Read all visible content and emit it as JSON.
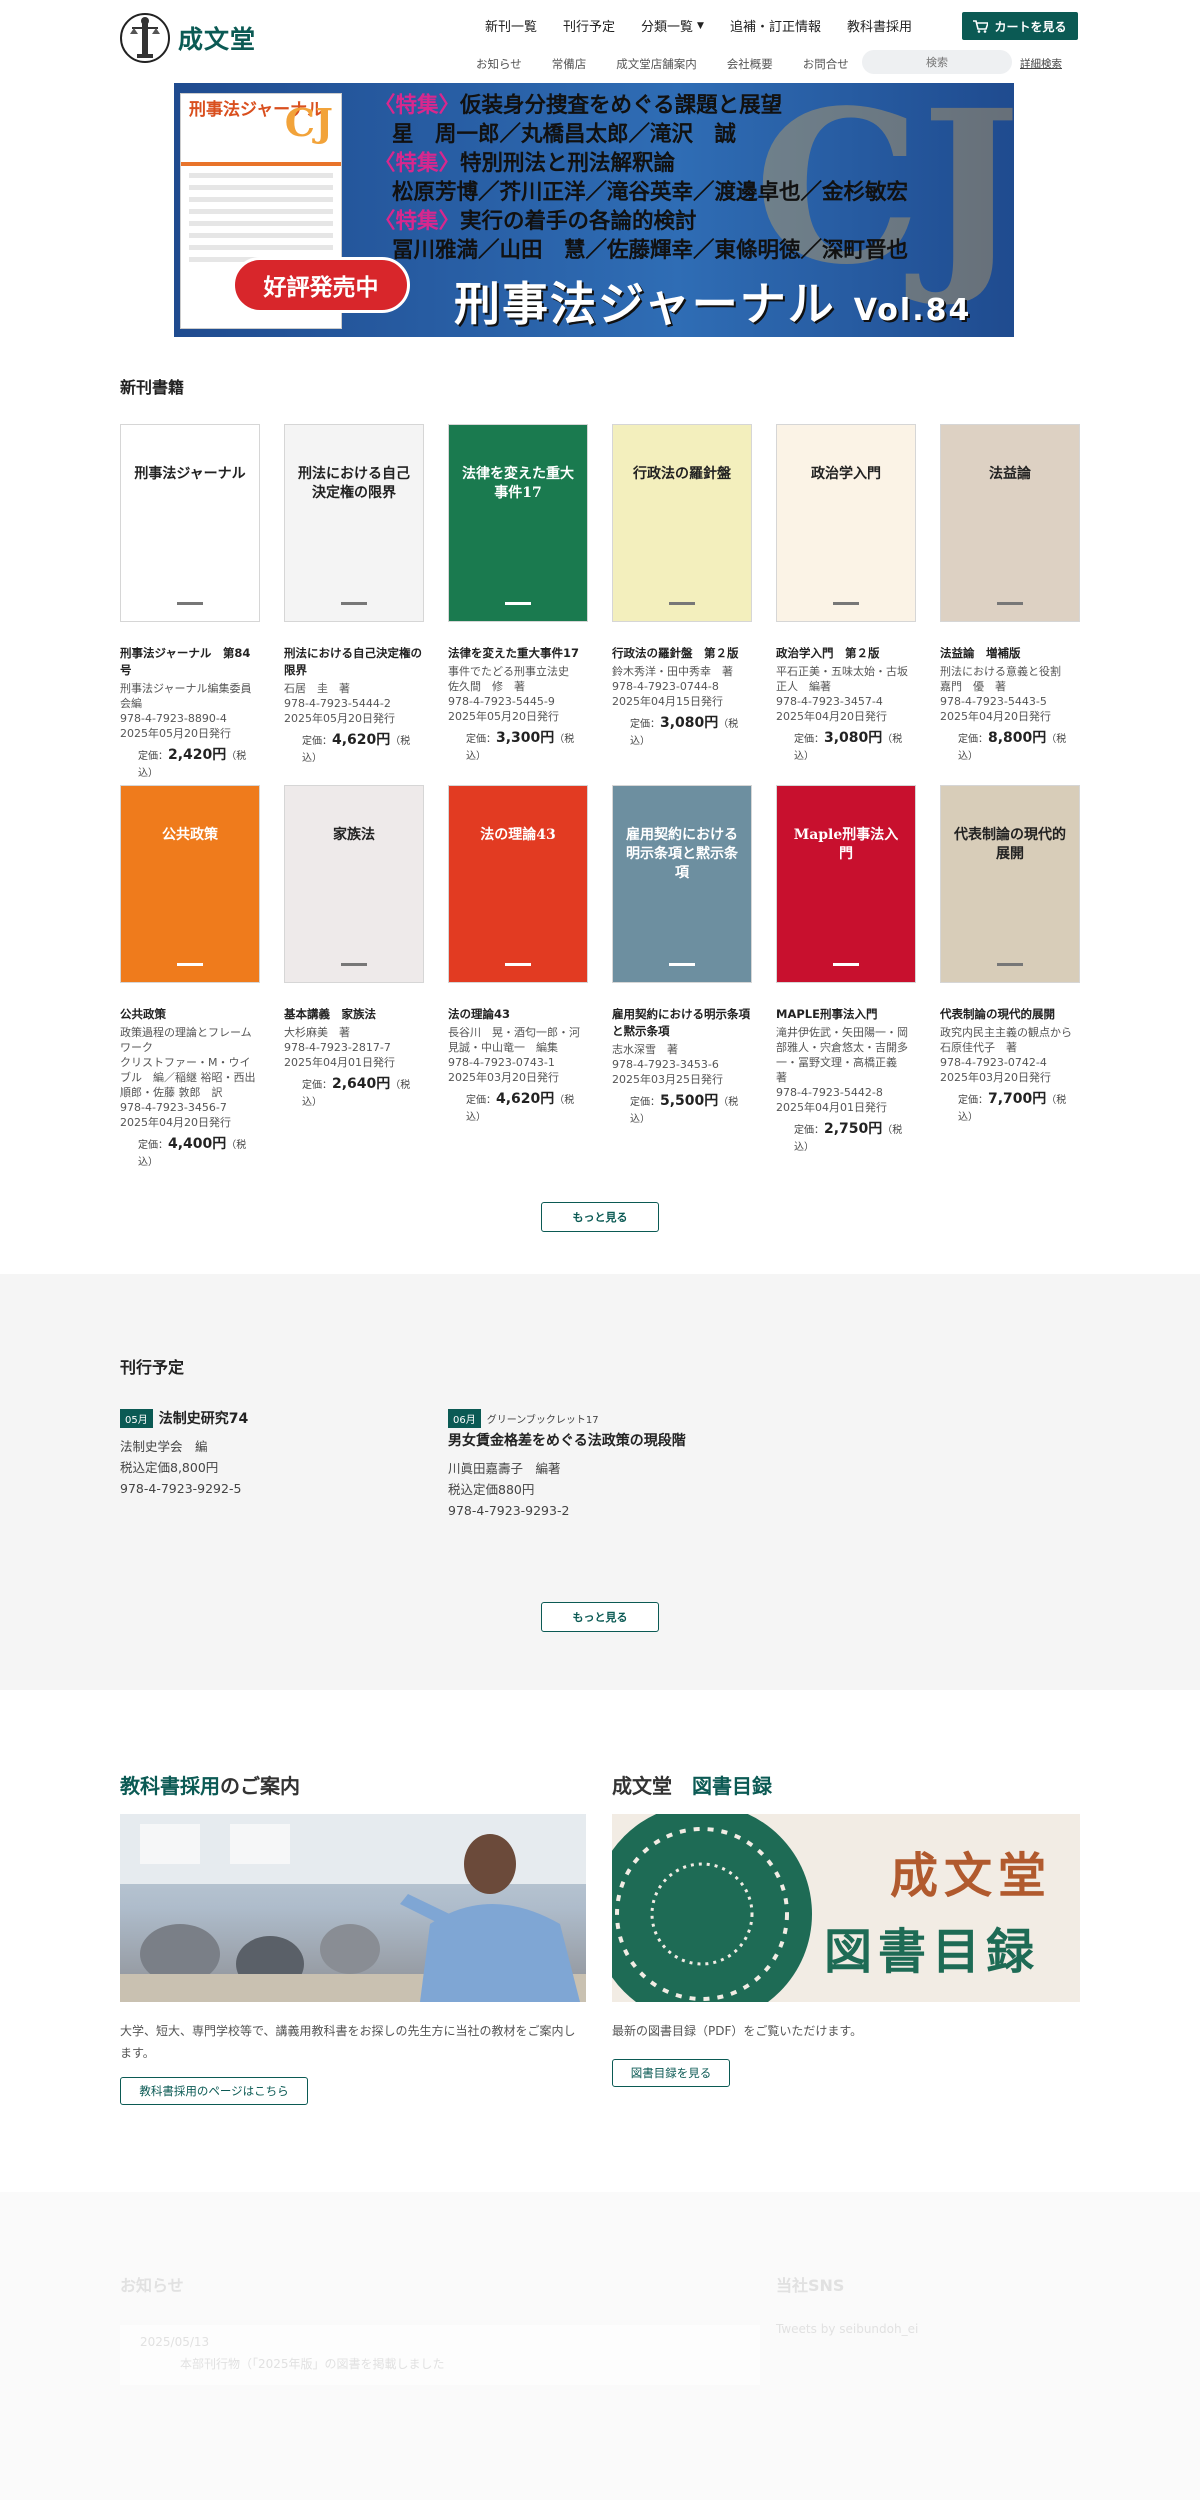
{
  "header": {
    "logo_text": "成文堂",
    "nav_main": [
      "新刊一覧",
      "刊行予定",
      "分類一覧",
      "追補・訂正情報",
      "教科書採用"
    ],
    "cart_label": "カートを見る",
    "nav_sub": [
      "お知らせ",
      "常備店",
      "成文堂店舗案内",
      "会社概要",
      "お問合せ"
    ],
    "search_placeholder": "検索",
    "advanced_search": "詳細検索"
  },
  "banner": {
    "lines": [
      {
        "tag": "〈特集〉",
        "text": "仮装身分捜査をめぐる課題と展望"
      },
      {
        "tag": "",
        "text": "星　周一郎／丸橋昌太郎／滝沢　誠"
      },
      {
        "tag": "〈特集〉",
        "text": "特別刑法と刑法解釈論"
      },
      {
        "tag": "",
        "text": "松原芳博／芥川正洋／滝谷英幸／渡邊卓也／金杉敏宏"
      },
      {
        "tag": "〈特集〉",
        "text": "実行の着手の各論的検討"
      },
      {
        "tag": "",
        "text": "冨川雅満／山田　慧／佐藤輝幸／東條明徳／深町晋也"
      }
    ],
    "badge": "好評発売中",
    "magazine_title": "刑事法ジャーナル",
    "magazine_vol": "Vol.84",
    "cover_title": "刑事法ジャーナル",
    "cover_logo": "CJ"
  },
  "new_books": {
    "title": "新刊書籍",
    "books": [
      {
        "title": "刑事法ジャーナル　第84号",
        "meta": [
          "刑事法ジャーナル編集委員会編",
          "978-4-7923-8890-4",
          "2025年05月20日発行"
        ],
        "price_prefix": "定価：",
        "price": "2,420円",
        "tax": "（税込）",
        "cover_text": "刑事法ジャーナル",
        "cover_color": "#ffffff"
      },
      {
        "title": "刑法における自己決定権の限界",
        "meta": [
          "石居　圭　著",
          "978-4-7923-5444-2",
          "2025年05月20日発行"
        ],
        "price_prefix": "定価：",
        "price": "4,620円",
        "tax": "（税込）",
        "cover_text": "刑法における自己決定権の限界",
        "cover_color": "#f4f4f4"
      },
      {
        "title": "法律を変えた重大事件17",
        "meta": [
          "事件でたどる刑事立法史",
          "佐久間　修　著",
          "978-4-7923-5445-9",
          "2025年05月20日発行"
        ],
        "price_prefix": "定価：",
        "price": "3,300円",
        "tax": "（税込）",
        "cover_text": "法律を変えた重大事件17",
        "cover_color": "#1a7a4f"
      },
      {
        "title": "行政法の羅針盤　第２版",
        "meta": [
          "鈴木秀洋・田中秀幸　著",
          "978-4-7923-0744-8",
          "2025年04月15日発行"
        ],
        "price_prefix": "定価：",
        "price": "3,080円",
        "tax": "（税込）",
        "cover_text": "行政法の羅針盤",
        "cover_color": "#f3efbd"
      },
      {
        "title": "政治学入門　第２版",
        "meta": [
          "平石正美・五味太始・古坂正人　編著",
          "978-4-7923-3457-4",
          "2025年04月20日発行"
        ],
        "price_prefix": "定価：",
        "price": "3,080円",
        "tax": "（税込）",
        "cover_text": "政治学入門",
        "cover_color": "#fbf3e6"
      },
      {
        "title": "法益論　増補版",
        "meta": [
          "刑法における意義と役割",
          "嘉門　優　著",
          "978-4-7923-5443-5",
          "2025年04月20日発行"
        ],
        "price_prefix": "定価：",
        "price": "8,800円",
        "tax": "（税込）",
        "cover_text": "法益論",
        "cover_color": "#ddd1c3"
      },
      {
        "title": "公共政策",
        "meta": [
          "政策過程の理論とフレームワーク",
          "クリストファー・M・ウイブル　編／稲継 裕昭・西出 順郎・佐藤 敦郎　訳",
          "978-4-7923-3456-7",
          "2025年04月20日発行"
        ],
        "price_prefix": "定価：",
        "price": "4,400円",
        "tax": "（税込）",
        "cover_text": "公共政策",
        "cover_color": "#ef7b1c"
      },
      {
        "title": "基本講義　家族法",
        "meta": [
          "大杉麻美　著",
          "978-4-7923-2817-7",
          "2025年04月01日発行"
        ],
        "price_prefix": "定価：",
        "price": "2,640円",
        "tax": "（税込）",
        "cover_text": "家族法",
        "cover_color": "#eeeaea"
      },
      {
        "title": "法の理論43",
        "meta": [
          "長谷川　晃・酒匂一郎・河見誠・中山竜一　編集",
          "978-4-7923-0743-1",
          "2025年03月20日発行"
        ],
        "price_prefix": "定価：",
        "price": "4,620円",
        "tax": "（税込）",
        "cover_text": "法の理論43",
        "cover_color": "#e23b22"
      },
      {
        "title": "雇用契約における明示条項と黙示条項",
        "meta": [
          "志水深雪　著",
          "978-4-7923-3453-6",
          "2025年03月25日発行"
        ],
        "price_prefix": "定価：",
        "price": "5,500円",
        "tax": "（税込）",
        "cover_text": "雇用契約における明示条項と黙示条項",
        "cover_color": "#6d8fa0"
      },
      {
        "title": "MAPLE刑事法入門",
        "meta": [
          "滝井伊佐武・矢田陽一・岡部雅人・宍倉悠太・吉開多一・冨野文理・高橋正義　著",
          "978-4-7923-5442-8",
          "2025年04月01日発行"
        ],
        "price_prefix": "定価：",
        "price": "2,750円",
        "tax": "（税込）",
        "cover_text": "Maple刑事法入門",
        "cover_color": "#c8102e"
      },
      {
        "title": "代表制論の現代的展開",
        "meta": [
          "政究内民主主義の観点から",
          "石原佳代子　著",
          "978-4-7923-0742-4",
          "2025年03月20日発行"
        ],
        "price_prefix": "定価：",
        "price": "7,700円",
        "tax": "（税込）",
        "cover_text": "代表制論の現代的展開",
        "cover_color": "#d8cdb9"
      }
    ],
    "more_label": "もっと見る"
  },
  "upcoming": {
    "title": "刊行予定",
    "items": [
      {
        "month": "05月",
        "series": "",
        "title": "法制史研究74",
        "meta": [
          "法制史学会　編",
          "税込定価8,800円",
          "978-4-7923-9292-5"
        ]
      },
      {
        "month": "06月",
        "series": "グリーンブックレット17",
        "title": "男女賃金格差をめぐる法政策の現段階",
        "meta": [
          "川眞田嘉壽子　編著",
          "税込定価880円",
          "978-4-7923-9293-2"
        ]
      }
    ],
    "more_label": "もっと見る"
  },
  "textbook": {
    "title_hl": "教科書採用",
    "title_rest": "のご案内",
    "desc": "大学、短大、専門学校等で、講義用教科書をお探しの先生方に当社の教材をご案内します。",
    "button": "教科書採用のページはこちら"
  },
  "catalog": {
    "title_a": "成文堂　",
    "title_hl": "図書目録",
    "image_text_1": "成文堂",
    "image_text_2": "図書目録",
    "desc": "最新の図書目録（PDF）をご覧いただけます。",
    "button": "図書目録を見る"
  },
  "footer": {
    "news_title": "お知らせ",
    "news_date": "2025/05/13",
    "news_text": "本部刊行物（「2025年版」の図書を掲載しました",
    "sns_title": "当社SNS",
    "sns_text": "Tweets by seibundoh_ei"
  },
  "colors": {
    "brand": "#0b5a54",
    "accent_pink": "#d8278e",
    "badge_red": "#d8262b"
  }
}
